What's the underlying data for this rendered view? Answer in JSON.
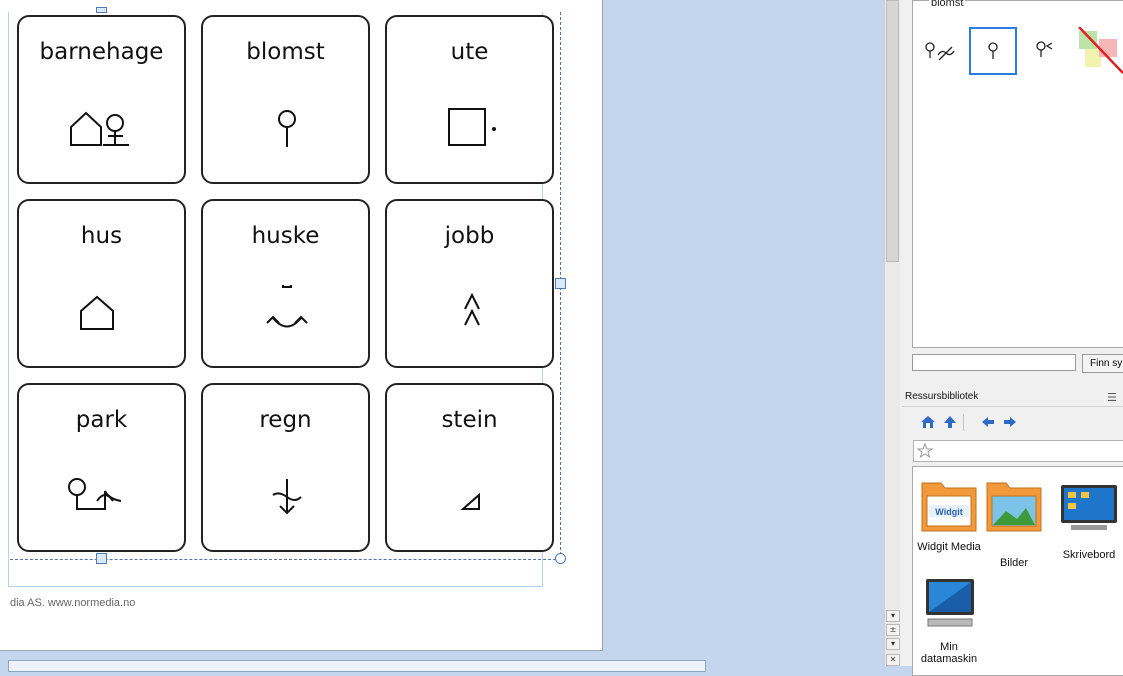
{
  "cells": [
    {
      "label": "barnehage",
      "symbol": "house-tree-symbol"
    },
    {
      "label": "blomst",
      "symbol": "flower-symbol"
    },
    {
      "label": "ute",
      "symbol": "outside-symbol"
    },
    {
      "label": "hus",
      "symbol": "house-symbol"
    },
    {
      "label": "huske",
      "symbol": "remember-symbol"
    },
    {
      "label": "jobb",
      "symbol": "work-symbol"
    },
    {
      "label": "park",
      "symbol": "park-symbol"
    },
    {
      "label": "regn",
      "symbol": "rain-symbol"
    },
    {
      "label": "stein",
      "symbol": "stone-symbol"
    }
  ],
  "footer": "dia  AS.  www.normedia.no",
  "symbol_panel": {
    "title": "blomst",
    "options": [
      "flower-not-symbol",
      "flower-symbol",
      "flower-small-symbol",
      "no-symbol-icon"
    ],
    "selected_index": 1
  },
  "search": {
    "value": "",
    "button_label": "Finn sy"
  },
  "resource_library": {
    "title": "Ressursbibliotek",
    "items": [
      {
        "label": "Widgit Media",
        "icon": "widgit-folder-icon",
        "badge": "Widgit"
      },
      {
        "label": "Bilder",
        "icon": "pictures-folder-icon"
      },
      {
        "label": "Skrivebord",
        "icon": "desktop-icon"
      },
      {
        "label": "Min datamaskin",
        "icon": "computer-icon"
      }
    ]
  },
  "scrollbar": {
    "close_glyph": "✕"
  }
}
